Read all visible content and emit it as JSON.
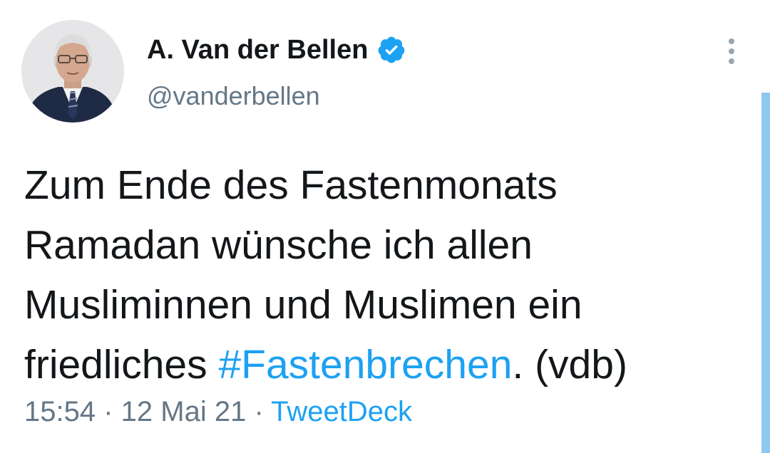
{
  "author": {
    "display_name": "A. Van der Bellen",
    "handle": "@vanderbellen",
    "verified": true
  },
  "tweet": {
    "text_lines": [
      "Zum Ende des Fastenmonats",
      "Ramadan wünsche ich allen",
      "Musliminnen und Muslimen ein"
    ],
    "last_line_prefix": "friedliches ",
    "hashtag": "#Fastenbrechen",
    "last_line_suffix": ". (vdb)"
  },
  "meta": {
    "time": "15:54",
    "separator": " · ",
    "date": "12 Mai 21",
    "separator2": " · ",
    "source": "TweetDeck"
  },
  "colors": {
    "accent": "#1da1f2",
    "secondary_text": "#657786",
    "primary_text": "#14171a"
  },
  "icons": {
    "verified": "verified-badge-icon",
    "more": "more-vertical-icon"
  }
}
